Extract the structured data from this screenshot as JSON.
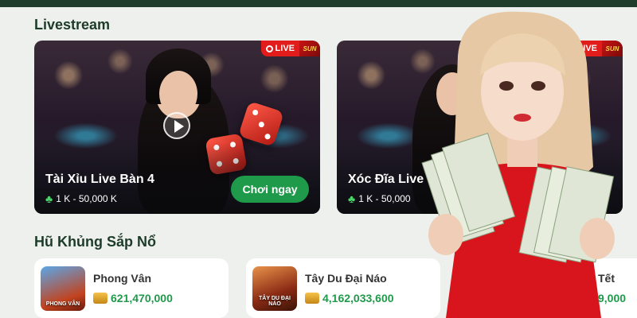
{
  "livestream": {
    "title": "Livestream",
    "cards": [
      {
        "title": "Tài Xỉu Live Bàn 4",
        "range": "1 K - 50,000 K",
        "play_label": "Chơi ngay",
        "live_label": "LIVE",
        "logo": "SUN"
      },
      {
        "title": "Xóc Đĩa Live",
        "range": "1 K - 50,000",
        "live_label": "LIVE",
        "logo": "SUN"
      }
    ]
  },
  "jackpots": {
    "title": "Hũ Khủng Sắp Nổ",
    "items": [
      {
        "name": "Phong Vân",
        "value": "621,470,000",
        "thumb_label": "PHONG VÂN"
      },
      {
        "name": "Tây Du Đại Náo",
        "value": "4,162,033,600",
        "thumb_label": "TÂY DU ĐẠI NÁO"
      },
      {
        "name": "Tết",
        "value": "9,000"
      }
    ]
  },
  "colors": {
    "accent": "#1f9a4a",
    "live": "#e21b1b",
    "header": "#1f3d2a"
  },
  "icons": [
    "live-broadcast-icon",
    "club-icon",
    "play-video-icon",
    "coin-icon"
  ]
}
